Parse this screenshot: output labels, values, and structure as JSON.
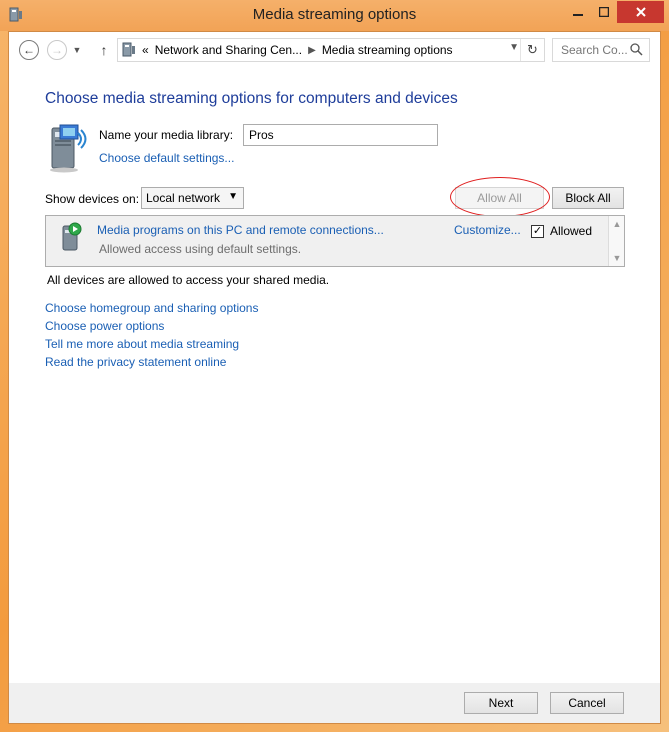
{
  "window": {
    "title": "Media streaming options",
    "minimize_icon": "minimize-icon",
    "maximize_icon": "maximize-icon",
    "close_icon": "close-icon"
  },
  "nav": {
    "back_icon": "back-arrow-icon",
    "forward_icon": "forward-arrow-icon",
    "recent_icon": "chevron-down-icon",
    "up_icon": "up-arrow-icon",
    "breadcrumb_prefix": "«",
    "breadcrumbs": [
      "Network and Sharing Cen...",
      "Media streaming options"
    ],
    "search_placeholder": "Search Co..."
  },
  "main": {
    "heading": "Choose media streaming options for computers and devices",
    "library_label": "Name your media library:",
    "library_value": "Pros",
    "default_settings_link": "Choose default settings...",
    "show_devices_label": "Show devices on:",
    "show_devices_value": "Local network",
    "allow_all_label": "Allow All",
    "block_all_label": "Block All",
    "device": {
      "title": "Media programs on this PC and remote connections...",
      "subtitle": "Allowed access using default settings.",
      "customize_label": "Customize...",
      "allowed_label": "Allowed",
      "allowed_checked": true
    },
    "status_text": "All devices are allowed to access your shared media.",
    "links": [
      "Choose homegroup and sharing options",
      "Choose power options",
      "Tell me more about media streaming",
      "Read the privacy statement online"
    ]
  },
  "footer": {
    "next_label": "Next",
    "cancel_label": "Cancel"
  },
  "colors": {
    "link": "#1a5fb4",
    "heading": "#1e3d9a",
    "close": "#c7372f",
    "annotation": "#e02020"
  }
}
